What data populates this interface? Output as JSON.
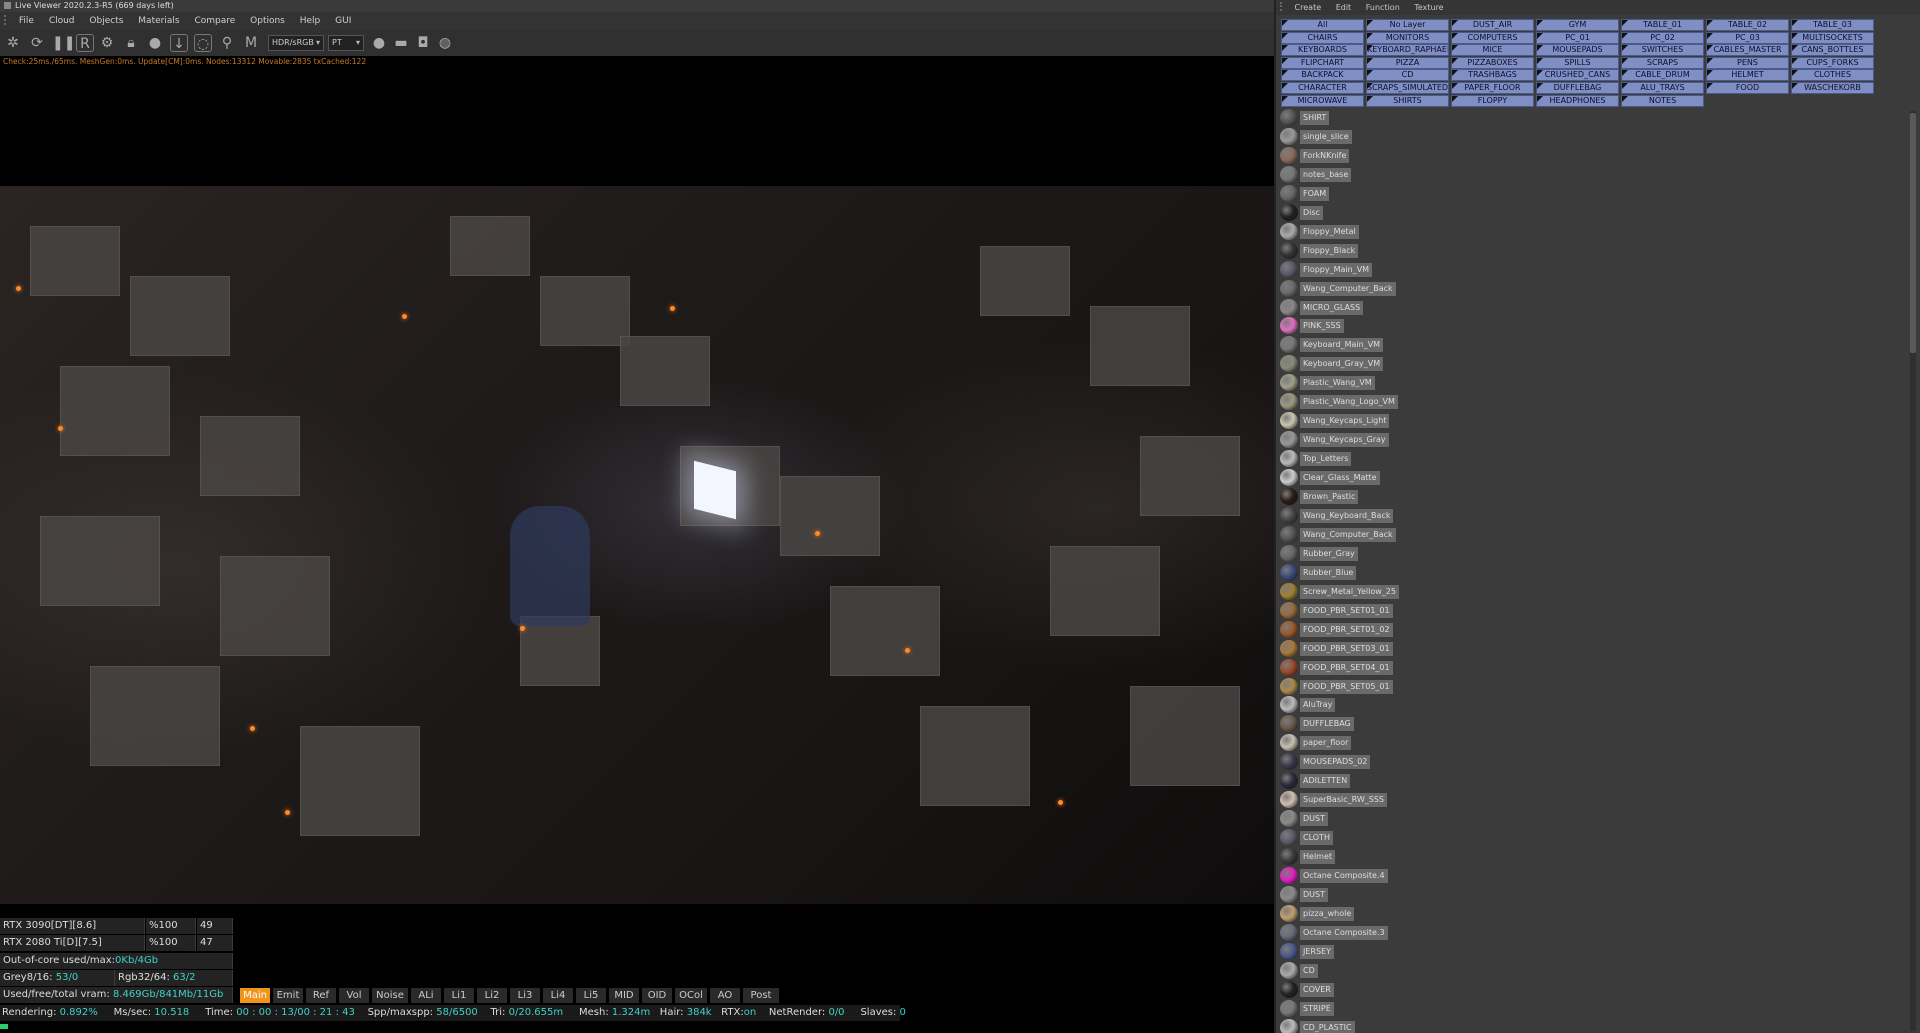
{
  "window": {
    "title": "Live Viewer 2020.2.3-R5 (669 days left)"
  },
  "menu": [
    "File",
    "Cloud",
    "Objects",
    "Materials",
    "Compare",
    "Options",
    "Help",
    "GUI"
  ],
  "toolbar": {
    "display_mode": "HDR/sRGB",
    "kernel": "PT"
  },
  "status_line": "Check:25ms./65ms. MeshGen:0ms. Update[CM]:0ms. Nodes:13312 Movable:2835 txCached:122",
  "gpus": [
    {
      "name": "RTX 3090[DT][8.6]",
      "pct": "%100",
      "val": "49"
    },
    {
      "name": "RTX 2080 Ti[D][7.5]",
      "pct": "%100",
      "val": "47"
    }
  ],
  "stats": {
    "ooc_label": "Out-of-core used/max:",
    "ooc_value": "0Kb/4Gb",
    "grey_label": "Grey8/16:",
    "grey_value": "53/0",
    "rgb_label": "Rgb32/64:",
    "rgb_value": "63/2",
    "vram_label": "Used/free/total vram:",
    "vram_value": "8.469Gb/841Mb/11Gb"
  },
  "pass_tabs": [
    "Main",
    "Emit",
    "Ref",
    "Vol",
    "Noise",
    "ALi",
    "Li1",
    "Li2",
    "Li3",
    "Li4",
    "Li5",
    "MID",
    "OID",
    "OCol",
    "AO",
    "Post"
  ],
  "render_line": {
    "rendering_label": "Rendering:",
    "rendering_value": "0.892%",
    "ms_label": "Ms/sec:",
    "ms_value": "10.518",
    "time_label": "Time:",
    "time_value": "00 : 00 : 13/00 : 21 : 43",
    "spp_label": "Spp/maxspp:",
    "spp_value": "58/6500",
    "tri_label": "Tri:",
    "tri_value": "0/20.655m",
    "mesh_label": "Mesh:",
    "mesh_value": "1.324m",
    "hair_label": "Hair:",
    "hair_value": "384k",
    "rtx_label": "RTX:",
    "rtx_value": "on",
    "net_label": "NetRender:",
    "net_value": "0/0",
    "slaves_label": "Slaves:",
    "slaves_value": "0"
  },
  "render_progress": 0.00892,
  "mat_menu": [
    "Create",
    "Edit",
    "Function",
    "Texture"
  ],
  "layers": [
    "All",
    "No Layer",
    "DUST_AIR",
    "GYM",
    "TABLE_01",
    "TABLE_02",
    "TABLE_03",
    "CHAIRS",
    "MONITORS",
    "COMPUTERS",
    "PC_01",
    "PC_02",
    "PC_03",
    "MULTISOCKETS",
    "KEYBOARDS",
    "KEYBOARD_RAPHAEL",
    "MICE",
    "MOUSEPADS",
    "SWITCHES",
    "CABLES_MASTER",
    "CANS_BOTTLES",
    "FLIPCHART",
    "PIZZA",
    "PIZZABOXES",
    "SPILLS",
    "SCRAPS",
    "PENS",
    "CUPS_FORKS",
    "BACKPACK",
    "CD",
    "TRASHBAGS",
    "CRUSHED_CANS",
    "CABLE_DRUM",
    "HELMET",
    "CLOTHES",
    "CHARACTER",
    "SCRAPS_SIMULATED",
    "PAPER_FLOOR",
    "DUFFLEBAG",
    "ALU_TRAYS",
    "FOOD",
    "WASCHEKORB",
    "MICROWAVE",
    "SHIRTS",
    "FLOPPY",
    "HEADPHONES",
    "NOTES"
  ],
  "materials": [
    "SHIRT",
    "single_slice",
    "ForkNKnife",
    "notes_base",
    "FOAM",
    "Disc",
    "Floppy_Metal",
    "Floppy_Black",
    "Floppy_Main_VM",
    "Wang_Computer_Back",
    "MICRO_GLASS",
    "PINK_SSS",
    "Keyboard_Main_VM",
    "Keyboard_Gray_VM",
    "Plastic_Wang_VM",
    "Plastic_Wang_Logo_VM",
    "Wang_Keycaps_Light",
    "Wang_Keycaps_Gray",
    "Top_Letters",
    "Clear_Glass_Matte",
    "Brown_Pastic",
    "Wang_Keyboard_Back",
    "Wang_Computer_Back",
    "Rubber_Gray",
    "Rubber_Blue",
    "Screw_Metal_Yellow_25",
    "FOOD_PBR_SET01_01",
    "FOOD_PBR_SET01_02",
    "FOOD_PBR_SET03_01",
    "FOOD_PBR_SET04_01",
    "FOOD_PBR_SET05_01",
    "AluTray",
    "DUFFLEBAG",
    "paper_floor",
    "MOUSEPADS_02",
    "ADILETTEN",
    "SuperBasic_RW_SSS",
    "DUST",
    "CLOTH",
    "Helmet",
    "Octane Composite.4",
    "DUST",
    "pizza_whole",
    "Octane Composite.3",
    "JERSEY",
    "CD",
    "COVER",
    "STRIPE",
    "CD_PLASTIC"
  ],
  "colors": {
    "accent": "#f0941b",
    "value_text": "#3fd2c6",
    "layer_button": "#7f8fc4",
    "status_text": "#c87a2a"
  }
}
